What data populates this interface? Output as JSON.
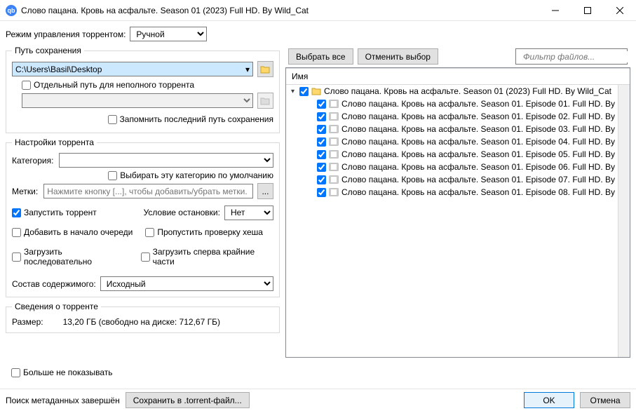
{
  "window": {
    "title": "Слово пацана. Кровь на асфальте. Season 01 (2023) Full HD. By Wild_Cat"
  },
  "mode": {
    "label": "Режим управления торрентом:",
    "value": "Ручной"
  },
  "buttons": {
    "select_all": "Выбрать все",
    "deselect_all": "Отменить выбор",
    "ok": "OK",
    "cancel": "Отмена",
    "save_torrent": "Сохранить в .torrent-файл...",
    "browse": "..."
  },
  "filter": {
    "placeholder": "Фильтр файлов..."
  },
  "save_path": {
    "legend": "Путь сохранения",
    "value": "C:\\Users\\Basil\\Desktop",
    "separate_path_label": "Отдельный путь для неполного торрента",
    "remember_label": "Запомнить последний путь сохранения"
  },
  "settings": {
    "legend": "Настройки торрента",
    "category_label": "Категория:",
    "category_default_label": "Выбирать эту категорию по умолчанию",
    "tags_label": "Метки:",
    "tags_placeholder": "Нажмите кнопку [...], чтобы добавить/убрать метки.",
    "start_torrent": "Запустить торрент",
    "stop_condition_label": "Условие остановки:",
    "stop_condition_value": "Нет",
    "add_top": "Добавить в начало очереди",
    "skip_hash": "Пропустить проверку хеша",
    "sequential": "Загрузить последовательно",
    "edge_pieces": "Загрузить сперва крайние части",
    "layout_label": "Состав содержимого:",
    "layout_value": "Исходный"
  },
  "info": {
    "legend": "Сведения о торренте",
    "size_label": "Размер:",
    "size_value": "13,20 ГБ (свободно на диске: 712,67 ГБ)"
  },
  "dont_show": "Больше не показывать",
  "status": "Поиск метаданных завершён",
  "tree": {
    "header": "Имя",
    "root": "Слово пацана. Кровь на асфальте. Season 01 (2023) Full HD. By Wild_Cat",
    "items": [
      "Слово пацана. Кровь на асфальте. Season 01. Episode 01. Full HD. By",
      "Слово пацана. Кровь на асфальте. Season 01. Episode 02. Full HD. By",
      "Слово пацана. Кровь на асфальте. Season 01. Episode 03. Full HD. By",
      "Слово пацана. Кровь на асфальте. Season 01. Episode 04. Full HD. By",
      "Слово пацана. Кровь на асфальте. Season 01. Episode 05. Full HD. By",
      "Слово пацана. Кровь на асфальте. Season 01. Episode 06. Full HD. By",
      "Слово пацана. Кровь на асфальте. Season 01. Episode 07. Full HD. By",
      "Слово пацана. Кровь на асфальте. Season 01. Episode 08. Full HD. By"
    ]
  }
}
